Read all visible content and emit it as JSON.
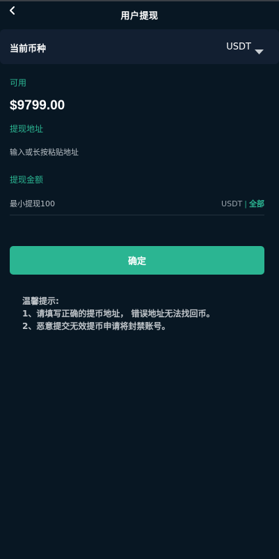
{
  "header": {
    "title": "用户提现"
  },
  "currency": {
    "label": "当前币种",
    "value": "USDT"
  },
  "available": {
    "label": "可用",
    "balance": "$9799.00"
  },
  "address": {
    "label": "提现地址",
    "placeholder": "输入或长按粘贴地址"
  },
  "amount": {
    "label": "提现金额",
    "placeholder": "最小提现100",
    "unit": "USDT",
    "separator": "|",
    "all_label": "全部"
  },
  "confirm_label": "确定",
  "tips": {
    "title": "温馨提示:",
    "lines": [
      "1、请填写正确的提币地址， 错误地址无法找回币。",
      "2、恶意提交无效提币申请将封禁账号。"
    ]
  },
  "colors": {
    "background": "#081723",
    "panel": "#121f31",
    "accent": "#2bb592"
  }
}
